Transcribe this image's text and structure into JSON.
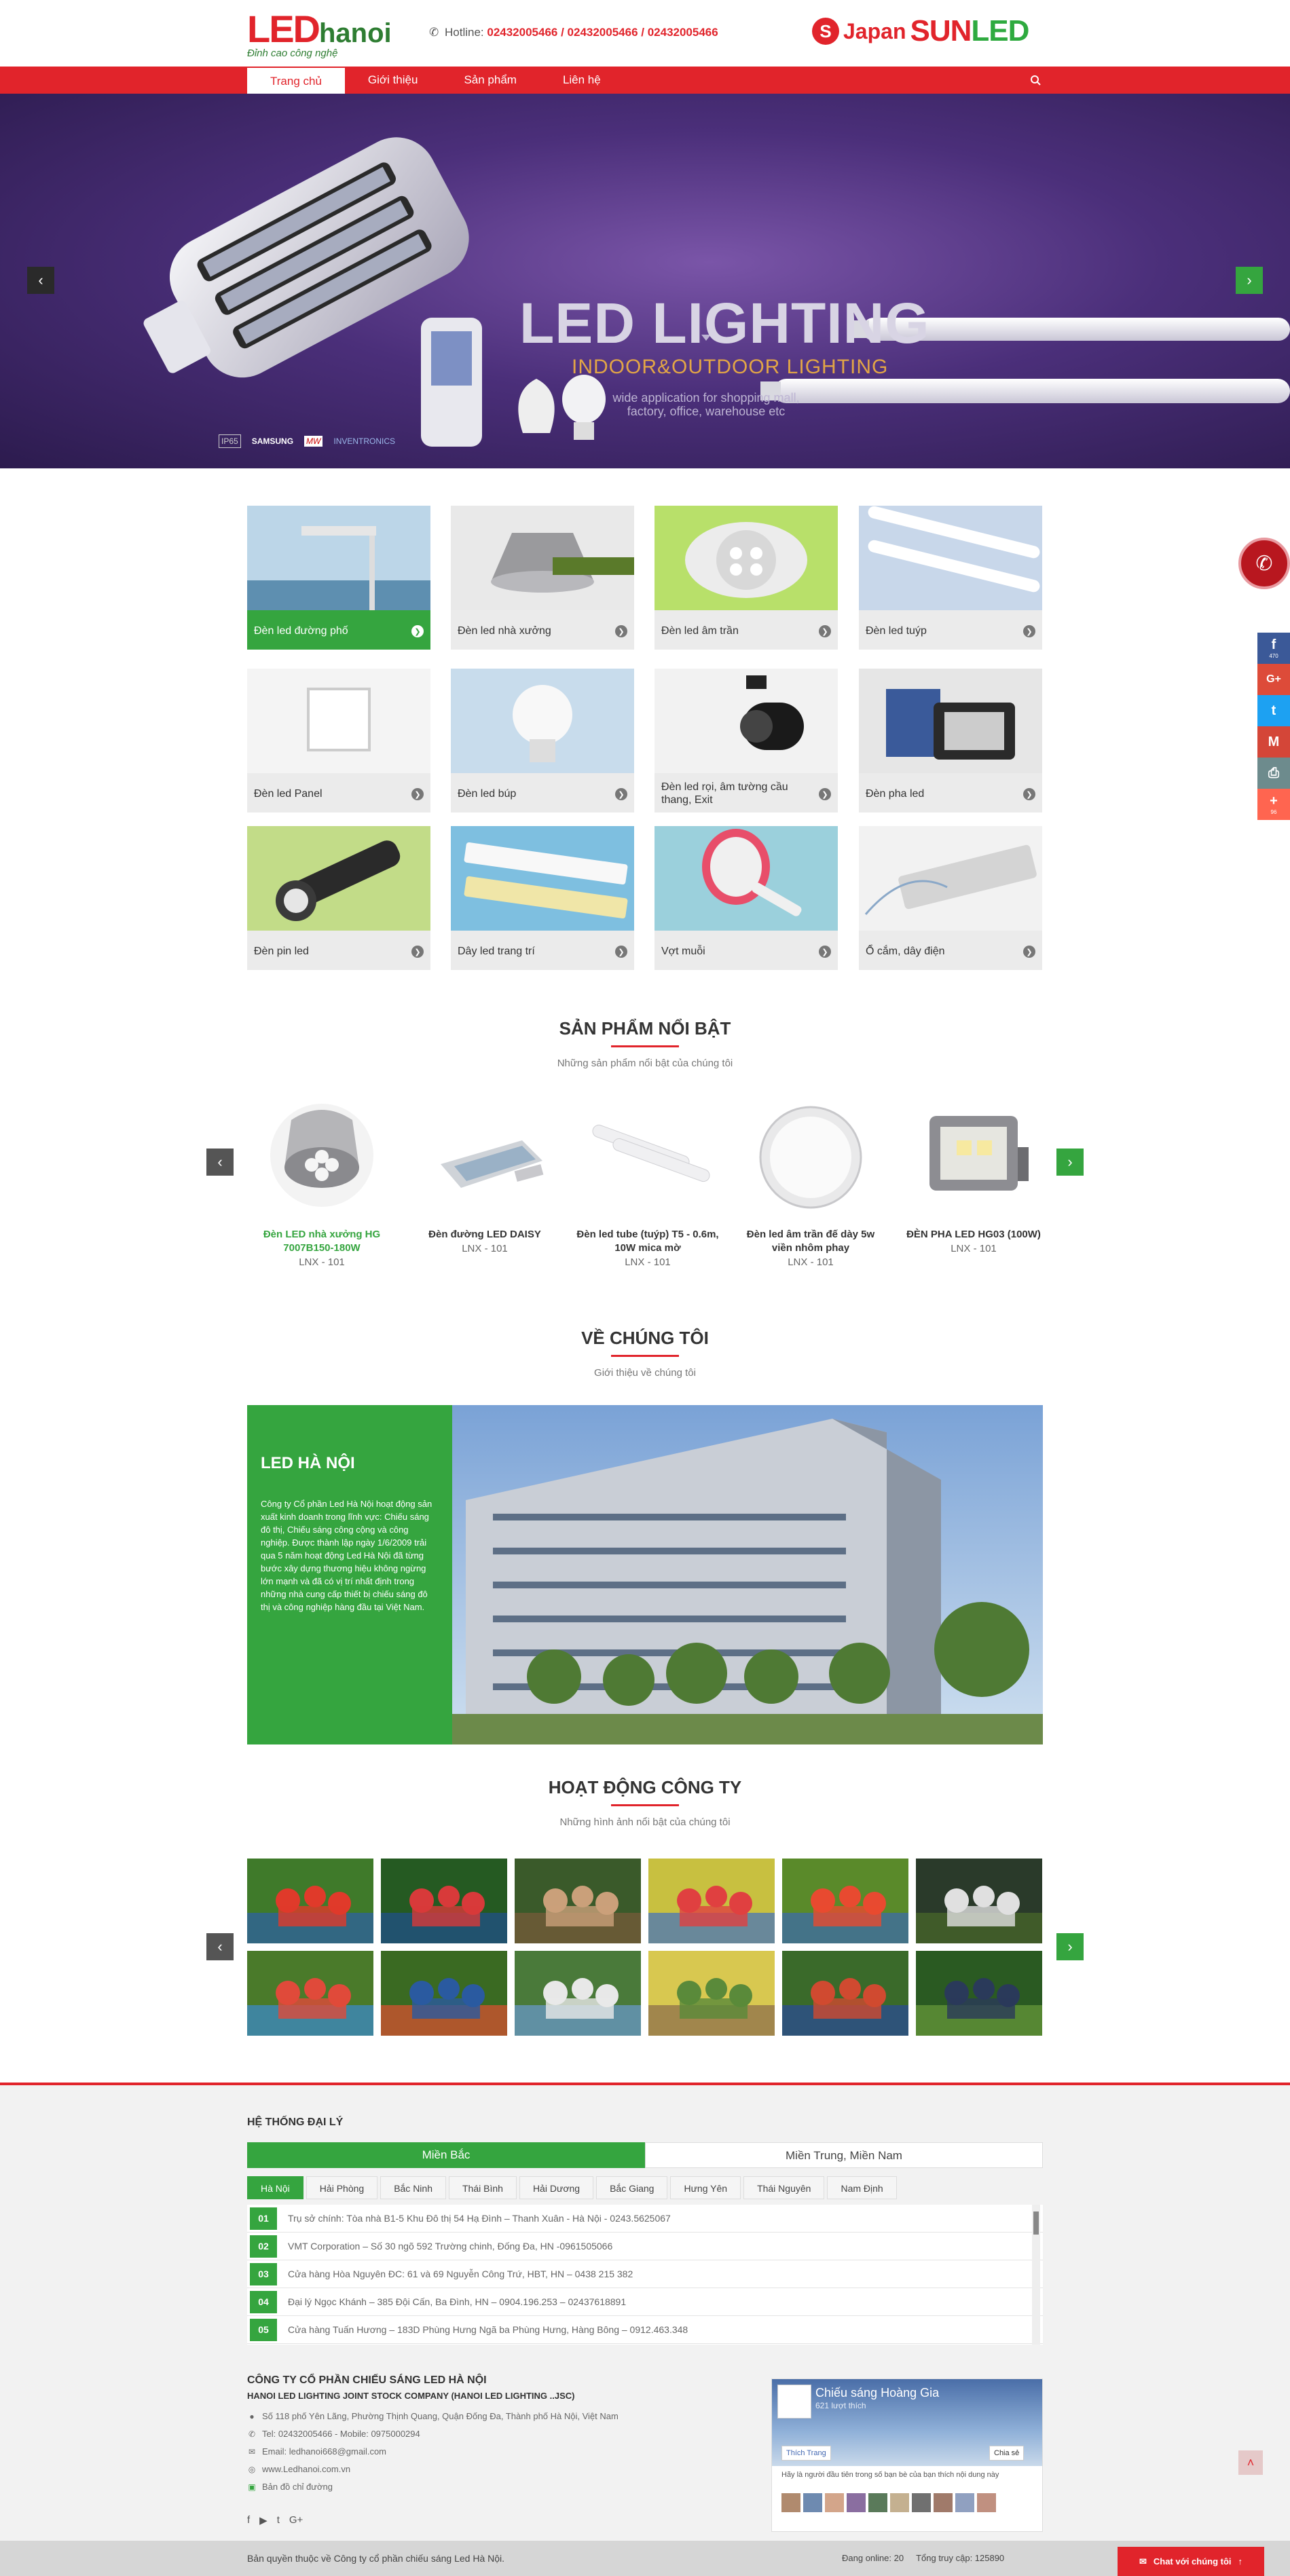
{
  "header": {
    "logo_led": "LED",
    "logo_hanoi": "hanoi",
    "slogan": "Đỉnh cao công nghệ",
    "hotline_label": "Hotline:",
    "hotline_numbers": "02432005466 / 02432005466 / 02432005466",
    "partner_japan": "Japan",
    "partner_sun": "SUN",
    "partner_led": "LED",
    "partner_badge": "S"
  },
  "nav": {
    "items": [
      "Trang chủ",
      "Giới thiệu",
      "Sản phẩm",
      "Liên hệ"
    ],
    "active_index": 0
  },
  "banner": {
    "title": "LED LIGHTING",
    "subtitle": "INDOOR&OUTDOOR LIGHTING",
    "description": "wide application for shopping mall, factory, office, warehouse etc",
    "brands": [
      "IP65",
      "SAMSUNG",
      "MW",
      "INVENTRONICS"
    ]
  },
  "categories": [
    {
      "label": "Đèn led đường phố",
      "active": true
    },
    {
      "label": "Đèn led nhà xưởng"
    },
    {
      "label": "Đèn led âm trần"
    },
    {
      "label": "Đèn led tuýp"
    },
    {
      "label": "Đèn led Panel"
    },
    {
      "label": "Đèn led búp"
    },
    {
      "label": "Đèn led rọi, âm tường cầu thang, Exit"
    },
    {
      "label": "Đèn pha led"
    },
    {
      "label": "Đèn pin led"
    },
    {
      "label": "Dây led trang trí"
    },
    {
      "label": "Vợt muỗi"
    },
    {
      "label": "Ổ cắm, dây điện"
    }
  ],
  "featured": {
    "title": "SẢN PHẨM NỔI BẬT",
    "subtitle": "Những sản phẩm nổi bật của chúng tôi",
    "products": [
      {
        "name": "Đèn LED nhà xưởng HG 7007B150-180W",
        "code": "LNX - 101"
      },
      {
        "name": "Đèn đường LED DAISY",
        "code": "LNX - 101"
      },
      {
        "name": "Đèn led tube (tuýp) T5 - 0.6m, 10W mica mờ",
        "code": "LNX - 101"
      },
      {
        "name": "Đèn led âm trần đế dày 5w viền nhôm phay",
        "code": "LNX - 101"
      },
      {
        "name": "ĐÈN PHA LED HG03 (100W)",
        "code": "LNX - 101"
      }
    ]
  },
  "about": {
    "title": "VỀ CHÚNG TÔI",
    "subtitle": "Giới thiệu về chúng tôi",
    "box_title": "LED HÀ NỘI",
    "box_text": "Công ty Cổ phần Led Hà Nội hoạt động sản xuất kinh doanh trong lĩnh vực: Chiếu sáng đô thị, Chiếu sáng công cộng và công nghiệp. Được thành lập ngày 1/6/2009 trải qua 5 năm hoạt động Led Hà Nội đã từng bước xây dựng thương hiệu không ngừng lớn mạnh và đã có vị trí nhất định trong những nhà cung cấp thiết bị chiếu sáng đô thị và công nghiệp hàng đầu tại Việt Nam."
  },
  "activities": {
    "title": "HOẠT ĐỘNG CÔNG TY",
    "subtitle": "Những hình ảnh nổi bật của chúng tôi"
  },
  "agency": {
    "title": "HỆ THỐNG ĐẠI LÝ",
    "tabs": [
      "Miền Bắc",
      "Miền Trung, Miền Nam"
    ],
    "subtabs": [
      "Hà Nội",
      "Hải Phòng",
      "Bắc Ninh",
      "Thái Bình",
      "Hải Dương",
      "Bắc Giang",
      "Hưng Yên",
      "Thái Nguyên",
      "Nam Định"
    ],
    "rows": [
      {
        "num": "01",
        "text": "Trụ sở chính: Tòa nhà B1-5 Khu Đô thị 54 Hạ Đình – Thanh Xuân - Hà Nội - 0243.5625067"
      },
      {
        "num": "02",
        "text": "VMT Corporation – Số 30 ngõ 592 Trường chinh, Đống Đa, HN -0961505066"
      },
      {
        "num": "03",
        "text": "Cửa hàng Hòa Nguyên ĐC: 61 và 69 Nguyễn Công Trứ, HBT, HN – 0438 215 382"
      },
      {
        "num": "04",
        "text": "Đại lý Ngọc Khánh – 385 Đội Cấn, Ba Đình, HN – 0904.196.253 – 02437618891"
      },
      {
        "num": "05",
        "text": "Cửa hàng Tuấn Hương – 183D Phùng Hưng Ngã ba Phùng Hưng, Hàng Bông – 0912.463.348"
      }
    ]
  },
  "company": {
    "name": "CÔNG TY CỔ PHẦN CHIẾU SÁNG LED HÀ NỘI",
    "name_en": "HANOI LED LIGHTING JOINT STOCK COMPANY (HANOI LED LIGHTING ..JSC)",
    "address": "Số 118 phố Yên Lãng, Phường Thịnh Quang, Quận Đống Đa, Thành phố Hà Nội, Việt Nam",
    "tel": "Tel: 02432005466 - Mobile: 0975000294",
    "email": "Email: ledhanoi668@gmail.com",
    "web": "www.Ledhanoi.com.vn",
    "map": "Bản đồ chỉ đường"
  },
  "facebook": {
    "page_name": "Chiếu sáng Hoàng Gia",
    "likes": "621 lượt thích",
    "like_label": "Thích Trang",
    "share_label": "Chia sẻ",
    "text": "Hãy là người đầu tiên trong số bạn bè của bạn thích nội dung này"
  },
  "bottom": {
    "copyright": "Bản quyền thuộc về Công ty cổ phần chiếu sáng Led Hà Nội.",
    "online": "Đang online: 20",
    "total": "Tổng truy cập: 125890",
    "chat": "Chat với chúng tôi"
  },
  "share_bar": {
    "fb_count": "470",
    "plus_count": "96"
  },
  "colors": {
    "brand_red": "#e1242b",
    "brand_green": "#35a53f"
  },
  "icons": [
    "phone-icon",
    "search-icon",
    "chevron-left-icon",
    "chevron-right-icon",
    "facebook-icon",
    "google-plus-icon",
    "twitter-icon",
    "gmail-icon",
    "print-icon",
    "plus-icon",
    "chat-icon",
    "arrow-up-icon"
  ]
}
